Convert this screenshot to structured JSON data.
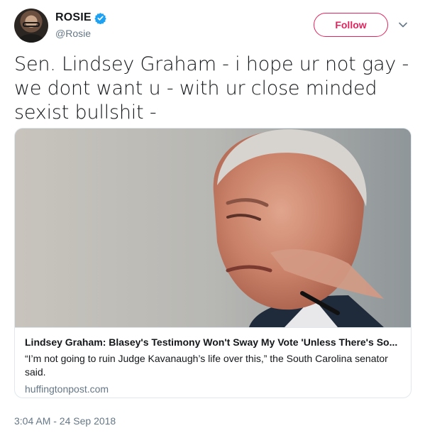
{
  "user": {
    "display_name": "ROSIE",
    "handle": "@Rosie"
  },
  "actions": {
    "follow_label": "Follow"
  },
  "tweet": {
    "text": "Sen. Lindsey Graham - i hope ur not gay - we dont want u - with ur close minded sexist bullshit -",
    "timestamp": "3:04 AM - 24 Sep 2018"
  },
  "card": {
    "title": "Lindsey Graham: Blasey's Testimony Won't Sway My Vote 'Unless There's So...",
    "description": "“I’m not going to ruin Judge Kavanaugh’s life over this,” the South Carolina senator said.",
    "domain": "huffingtonpost.com"
  },
  "colors": {
    "follow_accent": "#e0245e",
    "verified": "#1da1f2",
    "muted_text": "#657786"
  },
  "icons": [
    "verified-badge-icon",
    "chevron-down-icon"
  ]
}
